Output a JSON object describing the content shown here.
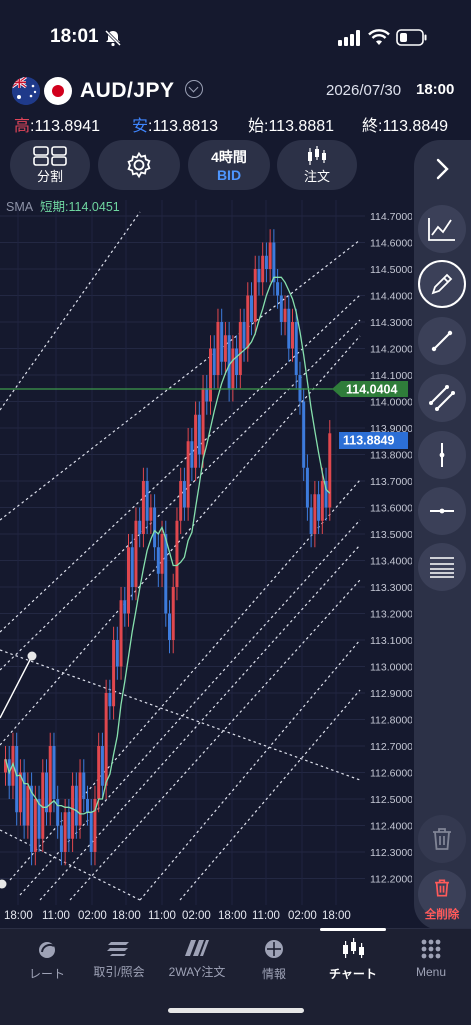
{
  "status": {
    "time": "18:01"
  },
  "header": {
    "pair": "AUD/JPY",
    "date": "2026/07/30",
    "time": "18:00",
    "ohlc": [
      {
        "label": "高",
        "value": ":113.8941"
      },
      {
        "label": "安",
        "value": ":113.8813"
      },
      {
        "label": "始",
        "value": ":113.8881"
      },
      {
        "label": "終",
        "value": ":113.8849"
      }
    ]
  },
  "toolbar": {
    "split": "分割",
    "period": "4時間",
    "period_mode": "BID",
    "order": "注文"
  },
  "chart": {
    "sma_prefix": "SMA",
    "sma_label": "短期:114.0451",
    "line_price": "114.0404",
    "current_price": "113.8849",
    "line_color": "#2f7d3a",
    "price_color": "#2c6fd6",
    "y_ticks": [
      "114.7000",
      "114.6000",
      "114.5000",
      "114.4000",
      "114.3000",
      "114.2000",
      "114.1000",
      "114.0000",
      "113.9000",
      "113.8000",
      "113.7000",
      "113.6000",
      "113.5000",
      "113.4000",
      "113.3000",
      "113.2000",
      "113.1000",
      "113.0000",
      "112.9000",
      "112.8000",
      "112.7000",
      "112.6000",
      "112.5000",
      "112.4000",
      "112.3000",
      "112.2000"
    ],
    "x_ticks": [
      "18:00",
      "11:00",
      "02:00",
      "18:00",
      "11:00",
      "02:00",
      "18:00",
      "11:00",
      "02:00",
      "18:00"
    ]
  },
  "tools": {
    "delete_all": "全削除"
  },
  "tabs": [
    {
      "label": "レート",
      "icon": "rate-icon"
    },
    {
      "label": "取引/照会",
      "icon": "trade-icon"
    },
    {
      "label": "2WAY注文",
      "icon": "twoway-icon"
    },
    {
      "label": "情報",
      "icon": "info-icon"
    },
    {
      "label": "チャート",
      "icon": "chart-icon",
      "active": true
    },
    {
      "label": "Menu",
      "icon": "menu-icon"
    }
  ]
}
